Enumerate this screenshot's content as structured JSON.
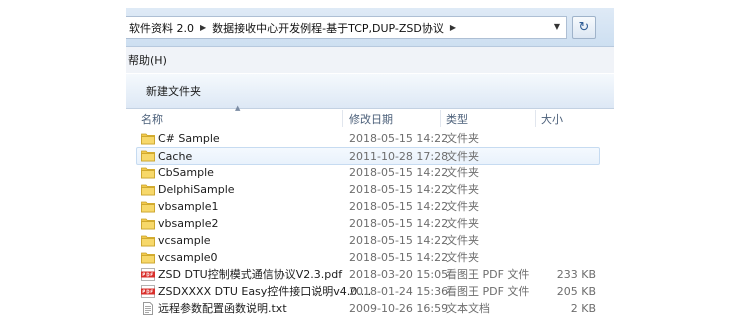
{
  "address": {
    "crumbs": [
      "软件资料 2.0",
      "数据接收中心开发例程-基于TCP,DUP-ZSD协议"
    ],
    "separator": "▶",
    "dropdown": "▼",
    "refresh": "↻"
  },
  "menu": {
    "help": "帮助(H)"
  },
  "toolbar": {
    "new_folder": "新建文件夹"
  },
  "columns": {
    "name": "名称",
    "date": "修改日期",
    "type": "类型",
    "size": "大小",
    "sort_indicator": "▲"
  },
  "colors": {
    "folder": "#f2c94c",
    "pdf": "#d9302c",
    "selection": "#cfe3f7"
  },
  "files": [
    {
      "name": "C# Sample",
      "date": "2018-05-15 14:22",
      "type": "文件夹",
      "size": "",
      "icon": "folder-icon"
    },
    {
      "name": "Cache",
      "date": "2011-10-28 17:28",
      "type": "文件夹",
      "size": "",
      "icon": "folder-icon",
      "selected": true
    },
    {
      "name": "CbSample",
      "date": "2018-05-15 14:22",
      "type": "文件夹",
      "size": "",
      "icon": "folder-icon"
    },
    {
      "name": "DelphiSample",
      "date": "2018-05-15 14:22",
      "type": "文件夹",
      "size": "",
      "icon": "folder-icon"
    },
    {
      "name": "vbsample1",
      "date": "2018-05-15 14:22",
      "type": "文件夹",
      "size": "",
      "icon": "folder-icon"
    },
    {
      "name": "vbsample2",
      "date": "2018-05-15 14:22",
      "type": "文件夹",
      "size": "",
      "icon": "folder-icon"
    },
    {
      "name": "vcsample",
      "date": "2018-05-15 14:22",
      "type": "文件夹",
      "size": "",
      "icon": "folder-icon"
    },
    {
      "name": "vcsample0",
      "date": "2018-05-15 14:22",
      "type": "文件夹",
      "size": "",
      "icon": "folder-icon"
    },
    {
      "name": "ZSD DTU控制模式通信协议V2.3.pdf",
      "date": "2018-03-20 15:05",
      "type": "看图王 PDF 文件",
      "size": "233 KB",
      "icon": "pdf-icon"
    },
    {
      "name": "ZSDXXXX DTU Easy控件接口说明v4.0....",
      "date": "2018-01-24 15:36",
      "type": "看图王 PDF 文件",
      "size": "205 KB",
      "icon": "pdf-icon"
    },
    {
      "name": "远程参数配置函数说明.txt",
      "date": "2009-10-26 16:59",
      "type": "文本文档",
      "size": "2 KB",
      "icon": "text-file-icon"
    }
  ]
}
